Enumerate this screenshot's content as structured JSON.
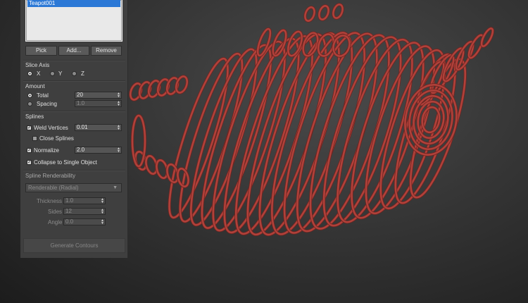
{
  "object_list": {
    "items": [
      "Teapot001"
    ]
  },
  "buttons": {
    "pick": "Pick",
    "add": "Add...",
    "remove": "Remove"
  },
  "slice_axis": {
    "title": "Slice Axis",
    "options": [
      {
        "label": "X",
        "selected": true
      },
      {
        "label": "Y",
        "selected": false
      },
      {
        "label": "Z",
        "selected": false
      }
    ]
  },
  "amount": {
    "title": "Amount",
    "total": {
      "label": "Total",
      "value": "20",
      "selected": true
    },
    "spacing": {
      "label": "Spacing",
      "value": "1.0",
      "selected": false
    }
  },
  "splines": {
    "title": "Splines",
    "weld_vertices": {
      "label": "Weld Vertices",
      "checked": true,
      "value": "0.01"
    },
    "close_splines": {
      "label": "Close Splines",
      "checked": false
    },
    "normalize": {
      "label": "Normalize",
      "checked": true,
      "value": "2.0"
    },
    "collapse": {
      "label": "Collapse to Single Object",
      "checked": true
    }
  },
  "renderability": {
    "title": "Spline Renderability",
    "mode": "Renderable (Radial)",
    "thickness": {
      "label": "Thickness",
      "value": "1.0"
    },
    "sides": {
      "label": "Sides",
      "value": "12"
    },
    "angle": {
      "label": "Angle",
      "value": "0.0"
    }
  },
  "generate_button": "Generate Contours",
  "colors": {
    "wire": "#b0413a",
    "wire_dark": "#6e2420",
    "selection": "#2b78d6"
  }
}
